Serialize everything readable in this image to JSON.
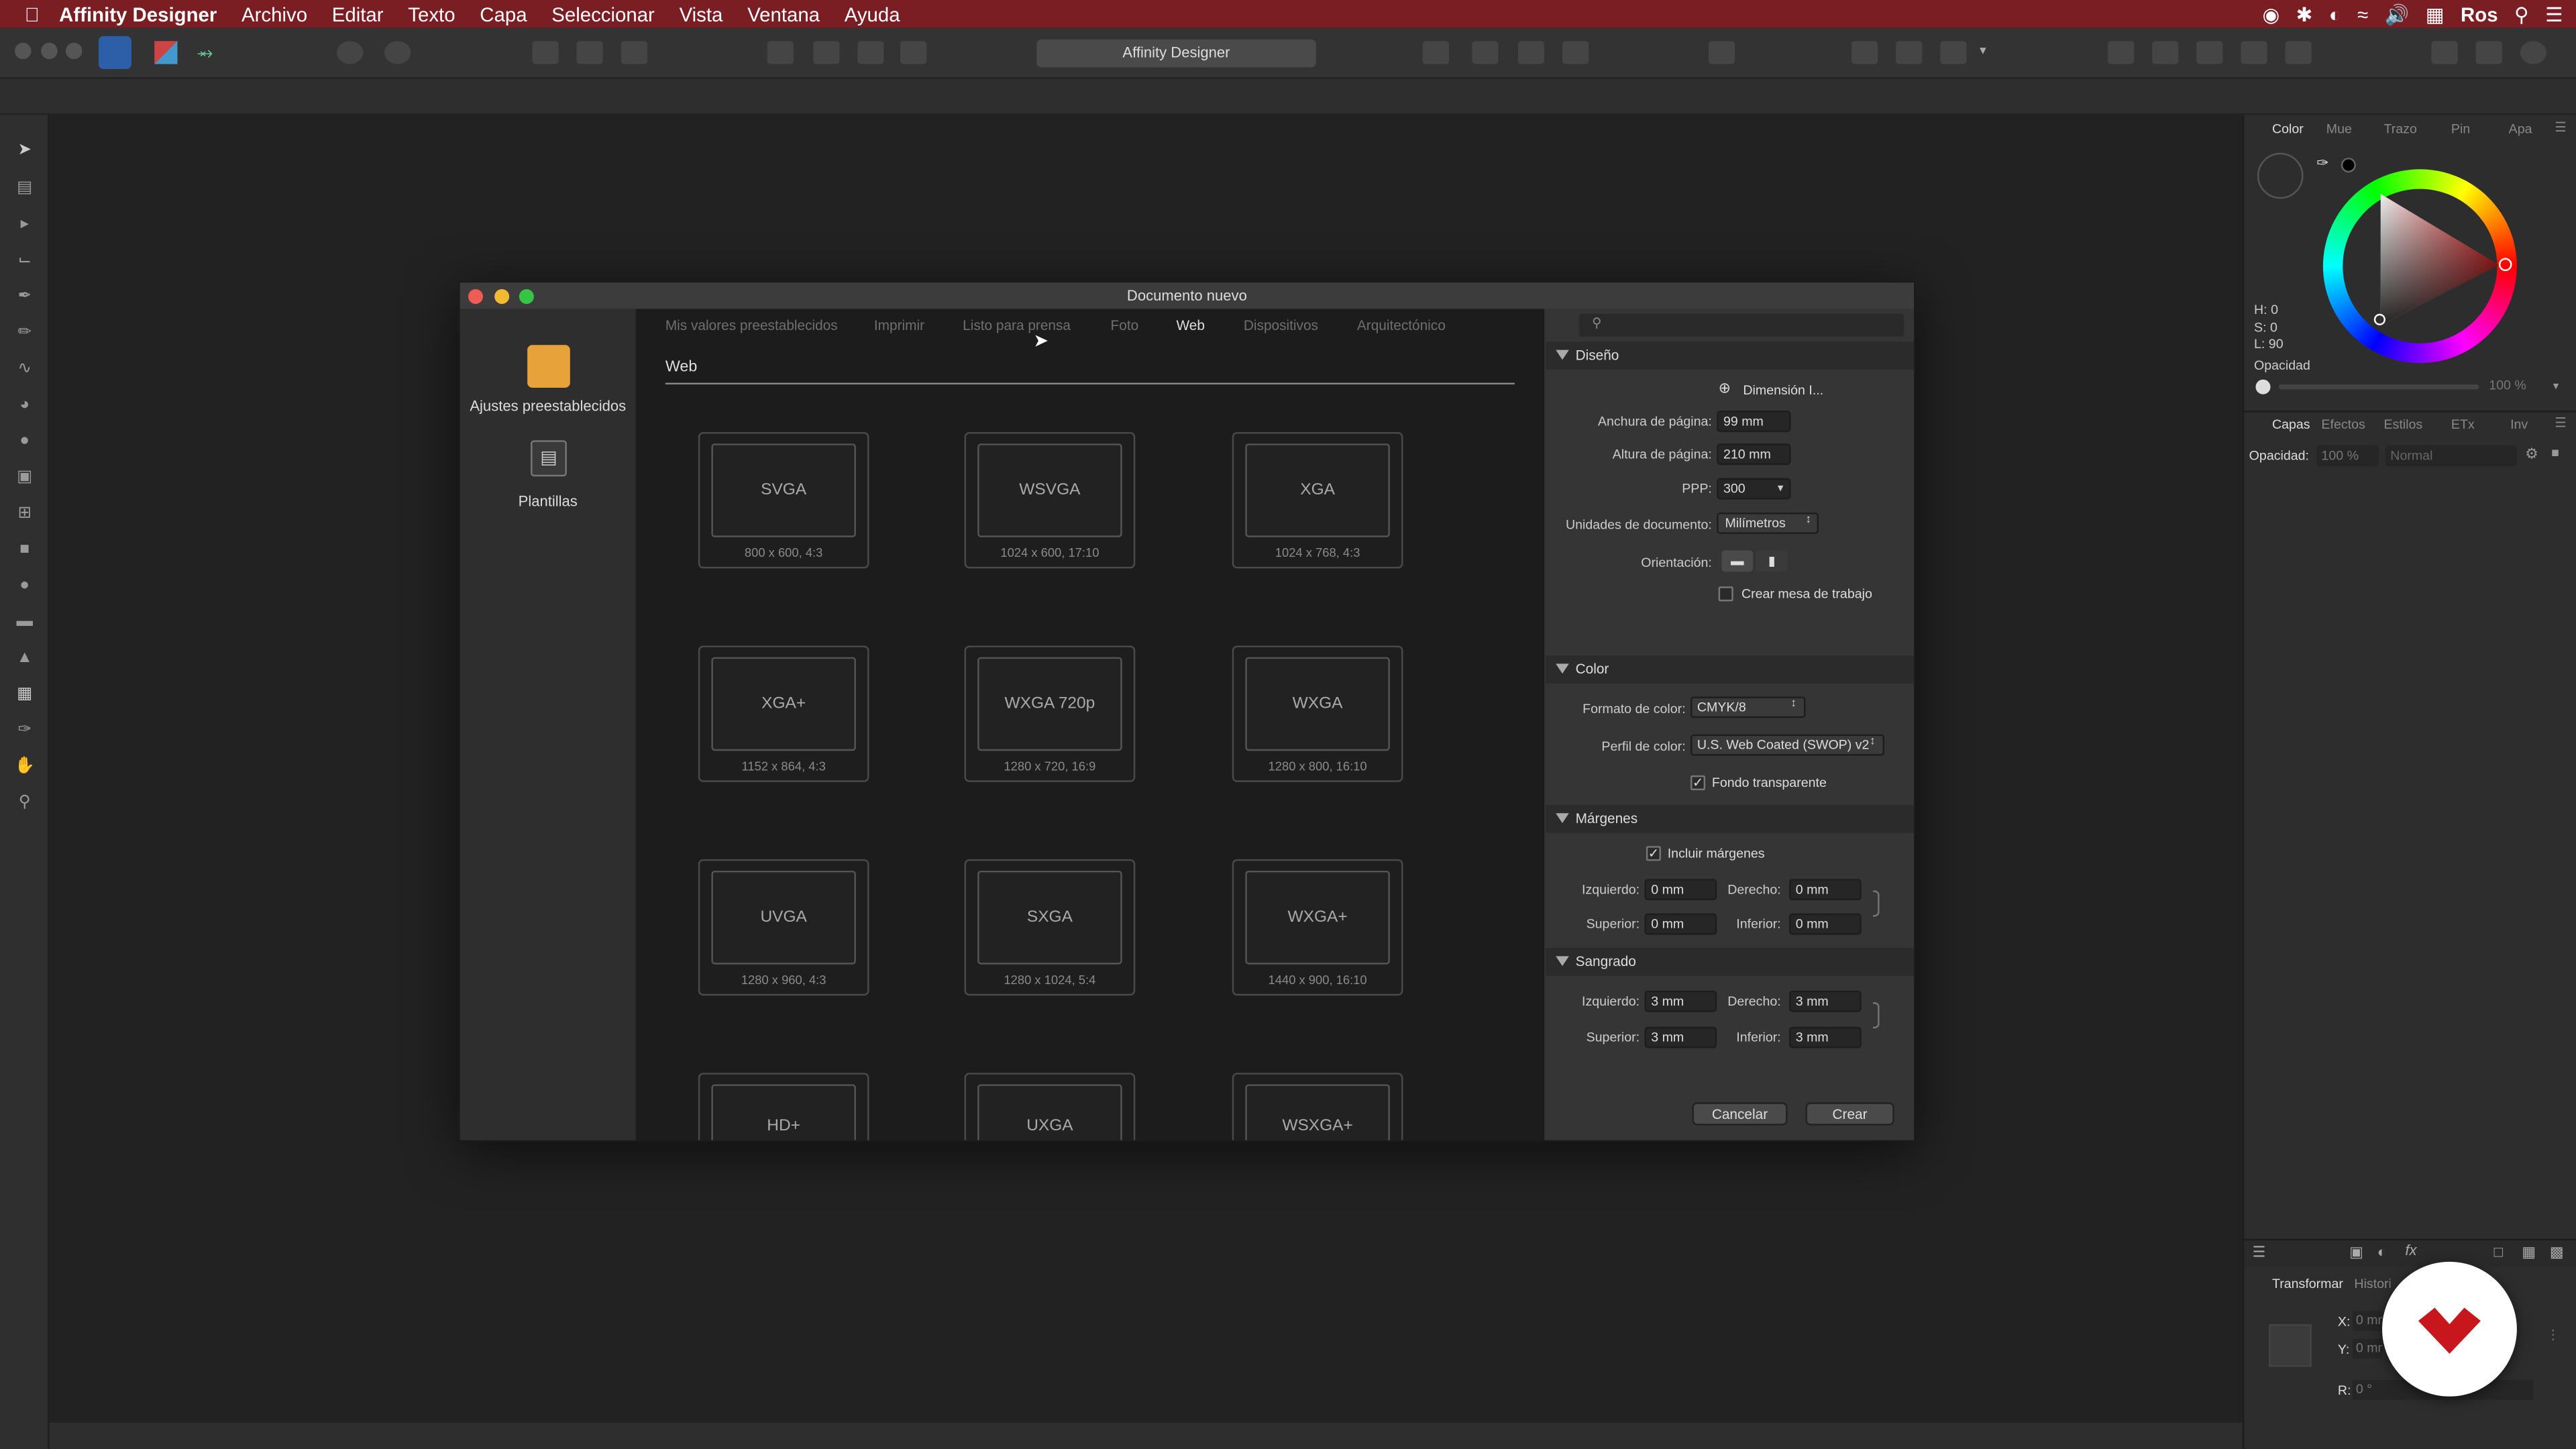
{
  "menubar": {
    "apple_icon": "apple-icon",
    "app_name": "Affinity Designer",
    "items": [
      "Archivo",
      "Editar",
      "Texto",
      "Capa",
      "Seleccionar",
      "Vista",
      "Ventana",
      "Ayuda"
    ],
    "user": "Ros"
  },
  "toolbar": {
    "title": "Affinity Designer"
  },
  "right_panel": {
    "tabs": [
      "Color",
      "Mue",
      "Trazo",
      "Pin",
      "Apa"
    ],
    "h_label": "H: 0",
    "s_label": "S: 0",
    "l_label": "L: 90",
    "opacity_label": "Opacidad",
    "opacity_value": "100 %",
    "layer_tabs": [
      "Capas",
      "Efectos",
      "Estilos",
      "ETx",
      "Inv"
    ],
    "layer_opacity_label": "Opacidad:",
    "layer_opacity_value": "100 %",
    "blend_mode": "Normal",
    "bottom_tabs": [
      "Transformar",
      "Historial"
    ],
    "x_label": "X:",
    "y_label": "Y:",
    "r_label": "R:",
    "x_value": "0 mm",
    "y_value": "0 mm",
    "r_value": "0 °"
  },
  "dialog": {
    "title": "Documento nuevo",
    "sidebar": [
      {
        "label": "Ajustes preestablecidos",
        "icon": "presets-icon"
      },
      {
        "label": "Plantillas",
        "icon": "templates-icon"
      }
    ],
    "tabs": [
      "Mis valores preestablecidos",
      "Imprimir",
      "Listo para prensa",
      "Foto",
      "Web",
      "Dispositivos",
      "Arquitectónico"
    ],
    "active_tab": "Web",
    "section_heading": "Web",
    "presets": [
      {
        "name": "SVGA",
        "dims": "800 x 600, 4:3"
      },
      {
        "name": "WSVGA",
        "dims": "1024 x 600, 17:10"
      },
      {
        "name": "XGA",
        "dims": "1024 x 768, 4:3"
      },
      {
        "name": "XGA+",
        "dims": "1152 x 864, 4:3"
      },
      {
        "name": "WXGA 720p",
        "dims": "1280 x 720, 16:9"
      },
      {
        "name": "WXGA",
        "dims": "1280 x 800, 16:10"
      },
      {
        "name": "UVGA",
        "dims": "1280 x 960, 4:3"
      },
      {
        "name": "SXGA",
        "dims": "1280 x 1024, 5:4"
      },
      {
        "name": "WXGA+",
        "dims": "1440 x 900, 16:10"
      },
      {
        "name": "HD+",
        "dims": ""
      },
      {
        "name": "UXGA",
        "dims": ""
      },
      {
        "name": "WSXGA+",
        "dims": ""
      }
    ],
    "search_placeholder": "",
    "layout": {
      "heading": "Diseño",
      "dimension_button": "Dimensión I...",
      "width_label": "Anchura de página:",
      "width_value": "99 mm",
      "height_label": "Altura de página:",
      "height_value": "210 mm",
      "dpi_label": "PPP:",
      "dpi_value": "300",
      "units_label": "Unidades de documento:",
      "units_value": "Milímetros",
      "orientation_label": "Orientación:",
      "artboard_label": "Crear mesa de trabajo",
      "artboard_checked": false
    },
    "color": {
      "heading": "Color",
      "format_label": "Formato de color:",
      "format_value": "CMYK/8",
      "profile_label": "Perfil de color:",
      "profile_value": "U.S. Web Coated (SWOP) v2",
      "transparent_label": "Fondo transparente",
      "transparent_checked": true
    },
    "margins": {
      "heading": "Márgenes",
      "include_label": "Incluir márgenes",
      "include_checked": true,
      "left_label": "Izquierdo:",
      "left_value": "0 mm",
      "right_label": "Derecho:",
      "right_value": "0 mm",
      "top_label": "Superior:",
      "top_value": "0 mm",
      "bottom_label": "Inferior:",
      "bottom_value": "0 mm"
    },
    "bleed": {
      "heading": "Sangrado",
      "left_label": "Izquierdo:",
      "left_value": "3 mm",
      "right_label": "Derecho:",
      "right_value": "3 mm",
      "top_label": "Superior:",
      "top_value": "3 mm",
      "bottom_label": "Inferior:",
      "bottom_value": "3 mm"
    },
    "cancel_label": "Cancelar",
    "create_label": "Crear"
  },
  "colors": {
    "menubar_bg": "#7a1e24",
    "preset_accent": "#e8a23a",
    "traffic_close": "#ee5c53",
    "traffic_min": "#f2b935",
    "traffic_max": "#37c343",
    "badge_red": "#c8161d"
  }
}
